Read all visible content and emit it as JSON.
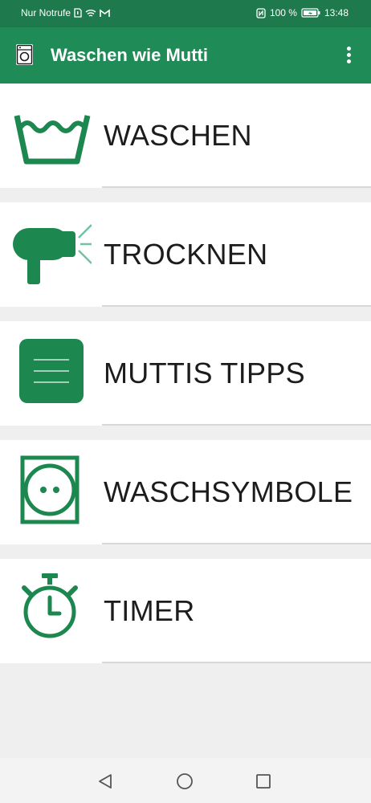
{
  "status_bar": {
    "carrier": "Nur Notrufe",
    "battery": "100 %",
    "time": "13:48"
  },
  "app_bar": {
    "title": "Waschen wie Mutti",
    "menu_icon": "more-vert-icon"
  },
  "menu_items": [
    {
      "label": "WASCHEN",
      "icon": "wash-basin-icon"
    },
    {
      "label": "TROCKNEN",
      "icon": "hair-dryer-icon"
    },
    {
      "label": "MUTTIS TIPPS",
      "icon": "notes-icon"
    },
    {
      "label": "WASCHSYMBOLE",
      "icon": "dryer-symbol-icon"
    },
    {
      "label": "TIMER",
      "icon": "stopwatch-icon"
    }
  ],
  "nav_bar": {
    "back": "back-icon",
    "home": "home-icon",
    "recents": "recents-icon"
  },
  "colors": {
    "primary": "#1f8b56",
    "status": "#1e7a4c",
    "icon_green": "#1d8750"
  }
}
